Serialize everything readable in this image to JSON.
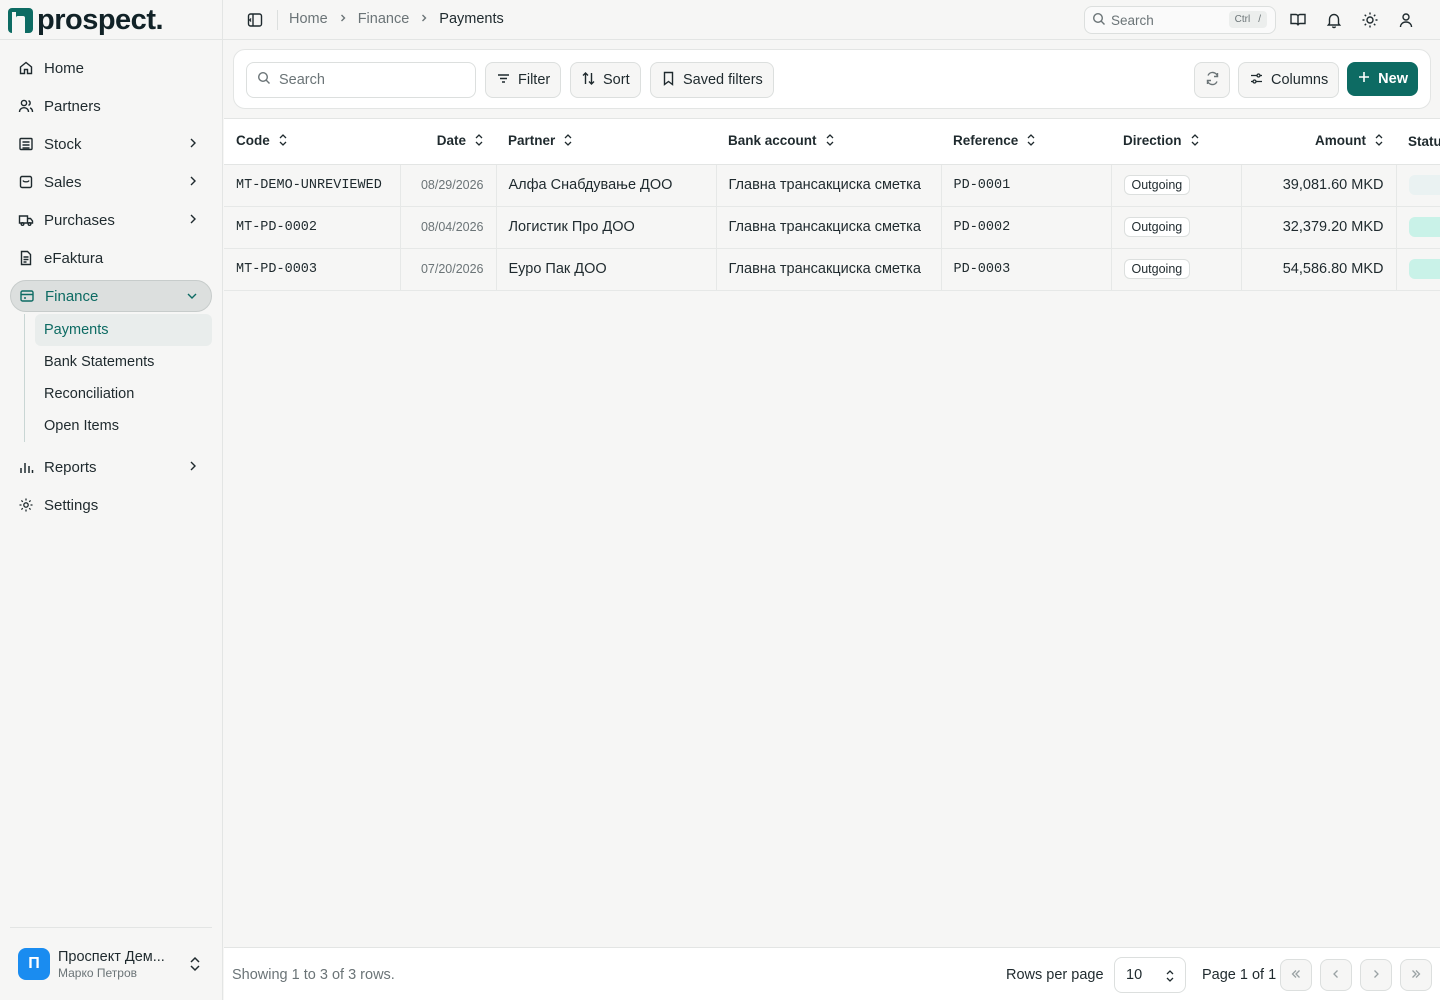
{
  "brand": {
    "name": "prospect."
  },
  "sidebar": {
    "items": [
      {
        "label": "Home",
        "icon": "home-icon"
      },
      {
        "label": "Partners",
        "icon": "users-icon"
      },
      {
        "label": "Stock",
        "icon": "warehouse-icon"
      },
      {
        "label": "Sales",
        "icon": "clipboard-icon"
      },
      {
        "label": "Purchases",
        "icon": "truck-icon"
      },
      {
        "label": "eFaktura",
        "icon": "document-icon"
      },
      {
        "label": "Finance",
        "icon": "wallet-icon"
      },
      {
        "label": "Reports",
        "icon": "bar-chart-icon"
      },
      {
        "label": "Settings",
        "icon": "gear-icon"
      }
    ],
    "finance_sub": [
      "Payments",
      "Bank Statements",
      "Reconciliation",
      "Open Items"
    ],
    "user": {
      "initial": "П",
      "company": "Проспект Дем...",
      "name": "Марко Петров"
    }
  },
  "header": {
    "breadcrumbs": [
      "Home",
      "Finance",
      "Payments"
    ],
    "search_placeholder": "Search",
    "kbd_ctrl": "Ctrl",
    "kbd_slash": "/"
  },
  "toolbar": {
    "search_placeholder": "Search",
    "filter_label": "Filter",
    "sort_label": "Sort",
    "saved_filters_label": "Saved filters",
    "columns_label": "Columns",
    "new_label": "New"
  },
  "table": {
    "columns": [
      "Code",
      "Date",
      "Partner",
      "Bank account",
      "Reference",
      "Direction",
      "Amount",
      "Statu"
    ],
    "rows": [
      {
        "code": "MT-DEMO-UNREVIEWED",
        "date": "08/29/2026",
        "partner": "Алфа Снабдување ДОО",
        "bank_account": "Главна трансакциска сметка",
        "reference": "PD-0001",
        "direction": "Outgoing",
        "amount": "39,081.60 MKD"
      },
      {
        "code": "MT-PD-0002",
        "date": "08/04/2026",
        "partner": "Логистик Про ДОО",
        "bank_account": "Главна трансакциска сметка",
        "reference": "PD-0002",
        "direction": "Outgoing",
        "amount": "32,379.20 MKD"
      },
      {
        "code": "MT-PD-0003",
        "date": "07/20/2026",
        "partner": "Еуро Пак ДОО",
        "bank_account": "Главна трансакциска сметка",
        "reference": "PD-0003",
        "direction": "Outgoing",
        "amount": "54,586.80 MKD"
      }
    ]
  },
  "footer": {
    "showing": "Showing 1 to 3 of 3 rows.",
    "rows_per_page_label": "Rows per page",
    "rows_per_page_value": "10",
    "page_info": "Page 1 of 1"
  },
  "colors": {
    "accent": "#0d6b63",
    "status_positive": "#c9f2e8",
    "avatar": "#1a8cf0"
  }
}
